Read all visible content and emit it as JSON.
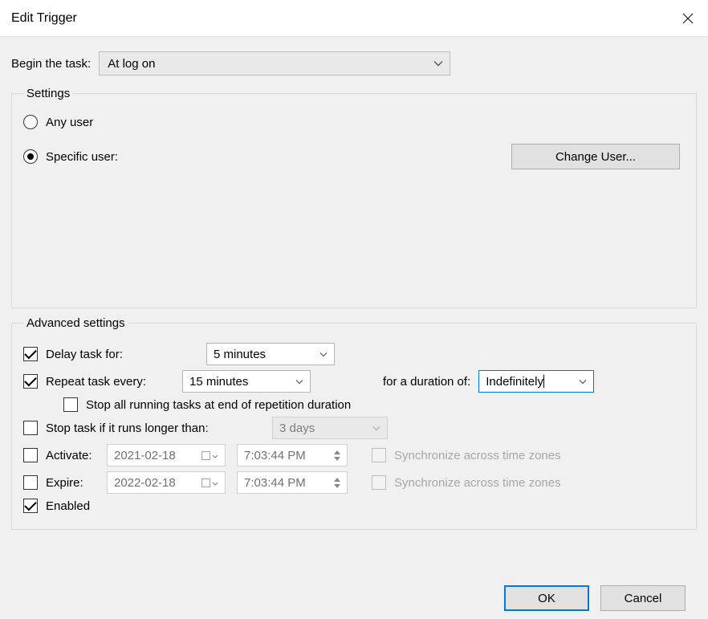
{
  "window": {
    "title": "Edit Trigger"
  },
  "begin": {
    "label": "Begin the task:",
    "selected": "At log on"
  },
  "settings": {
    "legend": "Settings",
    "any_user": {
      "label": "Any user",
      "checked": false
    },
    "specific_user": {
      "label": "Specific user:",
      "checked": true
    },
    "change_user_btn": "Change User..."
  },
  "advanced": {
    "legend": "Advanced settings",
    "delay": {
      "label": "Delay task for:",
      "checked": true,
      "value": "5 minutes"
    },
    "repeat": {
      "label": "Repeat task every:",
      "checked": true,
      "value": "15 minutes",
      "duration_label": "for a duration of:",
      "duration_value": "Indefinitely",
      "stop_all_label": "Stop all running tasks at end of repetition duration",
      "stop_all_checked": false
    },
    "stop_if": {
      "label": "Stop task if it runs longer than:",
      "checked": false,
      "value": "3 days"
    },
    "activate": {
      "label": "Activate:",
      "checked": false,
      "date": "2021-02-18",
      "time": "7:03:44 PM",
      "sync_label": "Synchronize across time zones",
      "sync_checked": false
    },
    "expire": {
      "label": "Expire:",
      "checked": false,
      "date": "2022-02-18",
      "time": "7:03:44 PM",
      "sync_label": "Synchronize across time zones",
      "sync_checked": false
    },
    "enabled": {
      "label": "Enabled",
      "checked": true
    }
  },
  "footer": {
    "ok": "OK",
    "cancel": "Cancel"
  }
}
